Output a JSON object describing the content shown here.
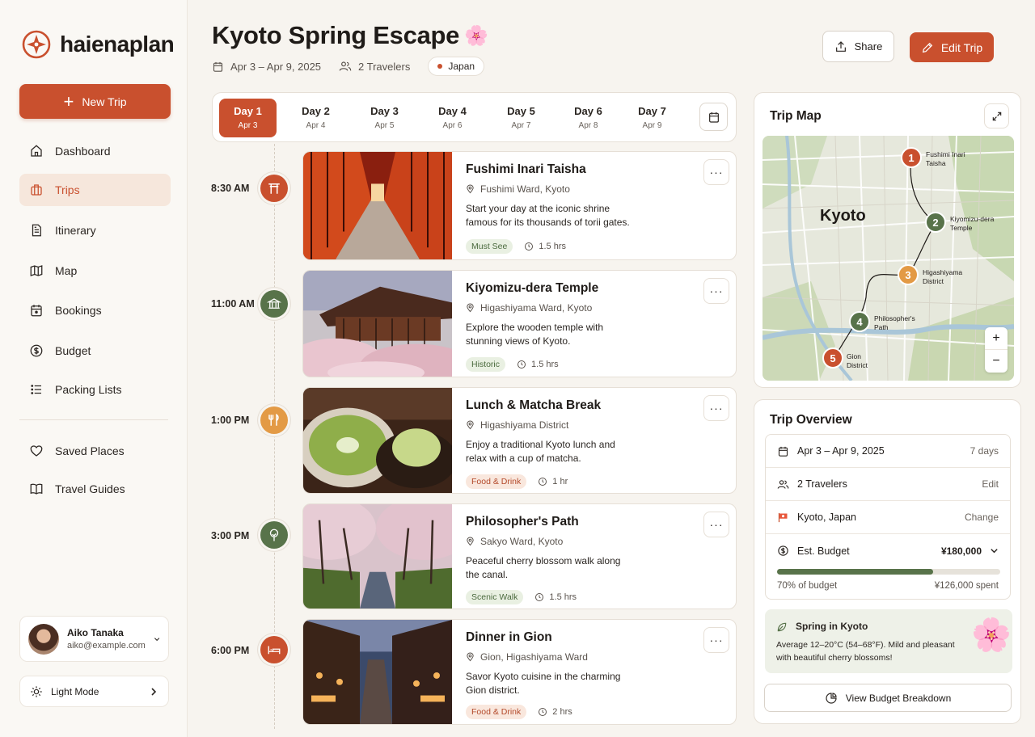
{
  "brand": {
    "name": "haienaplan"
  },
  "sidebar": {
    "new_trip": "New Trip",
    "items": [
      {
        "label": "Dashboard"
      },
      {
        "label": "Trips"
      },
      {
        "label": "Itinerary"
      },
      {
        "label": "Map"
      },
      {
        "label": "Bookings"
      },
      {
        "label": "Budget"
      },
      {
        "label": "Packing Lists"
      }
    ],
    "secondary": [
      {
        "label": "Saved Places"
      },
      {
        "label": "Travel Guides"
      }
    ],
    "user": {
      "name": "Aiko Tanaka",
      "email": "aiko@example.com"
    },
    "mode": "Light Mode"
  },
  "header": {
    "title": "Kyoto Spring Escape",
    "title_emoji": "🌸",
    "dates": "Apr 3 – Apr 9, 2025",
    "travelers": "2 Travelers",
    "country": "Japan",
    "share": "Share",
    "edit": "Edit Trip"
  },
  "days": [
    {
      "label": "Day 1",
      "date": "Apr 3"
    },
    {
      "label": "Day 2",
      "date": "Apr 4"
    },
    {
      "label": "Day 3",
      "date": "Apr 5"
    },
    {
      "label": "Day 4",
      "date": "Apr 6"
    },
    {
      "label": "Day 5",
      "date": "Apr 7"
    },
    {
      "label": "Day 6",
      "date": "Apr 8"
    },
    {
      "label": "Day 7",
      "date": "Apr 9"
    }
  ],
  "activities": [
    {
      "time": "8:30 AM",
      "title": "Fushimi Inari Taisha",
      "location": "Fushimi Ward, Kyoto",
      "desc": "Start your day at the iconic shrine famous for its thousands of torii gates.",
      "tag": "Must See",
      "duration": "1.5 hrs",
      "icon": "torii-icon",
      "color": "#c9502e"
    },
    {
      "time": "11:00 AM",
      "title": "Kiyomizu-dera Temple",
      "location": "Higashiyama Ward, Kyoto",
      "desc": "Explore the wooden temple with stunning views of Kyoto.",
      "tag": "Historic",
      "duration": "1.5 hrs",
      "icon": "temple-icon",
      "color": "#58734a"
    },
    {
      "time": "1:00 PM",
      "title": "Lunch & Matcha Break",
      "location": "Higashiyama District",
      "desc": "Enjoy a traditional Kyoto lunch and relax with a cup of matcha.",
      "tag": "Food & Drink",
      "duration": "1 hr",
      "icon": "utensils-icon",
      "color": "#e39a45"
    },
    {
      "time": "3:00 PM",
      "title": "Philosopher's Path",
      "location": "Sakyo Ward, Kyoto",
      "desc": "Peaceful cherry blossom walk along the canal.",
      "tag": "Scenic Walk",
      "duration": "1.5 hrs",
      "icon": "tree-icon",
      "color": "#58734a"
    },
    {
      "time": "6:00 PM",
      "title": "Dinner in Gion",
      "location": "Gion, Higashiyama Ward",
      "desc": "Savor Kyoto cuisine in the charming Gion district.",
      "tag": "Food & Drink",
      "duration": "2 hrs",
      "icon": "bed-icon",
      "color": "#c9502e"
    }
  ],
  "map": {
    "title": "Trip Map",
    "city": "Kyoto",
    "pins": [
      {
        "n": "1",
        "label_a": "Fushimi Inari",
        "label_b": "Taisha",
        "color": "#c9502e"
      },
      {
        "n": "2",
        "label_a": "Kiyomizu-dera",
        "label_b": "Temple",
        "color": "#58734a"
      },
      {
        "n": "3",
        "label_a": "Higashiyama",
        "label_b": "District",
        "color": "#e39a45"
      },
      {
        "n": "4",
        "label_a": "Philosopher's",
        "label_b": "Path",
        "color": "#58734a"
      },
      {
        "n": "5",
        "label_a": "Gion",
        "label_b": "District",
        "color": "#c9502e"
      }
    ]
  },
  "overview": {
    "title": "Trip Overview",
    "dates": "Apr 3 – Apr 9, 2025",
    "days": "7 days",
    "travelers": "2 Travelers",
    "edit": "Edit",
    "location": "Kyoto, Japan",
    "change": "Change",
    "budget_label": "Est. Budget",
    "budget_value": "¥180,000",
    "budget_percent": 70,
    "budget_pct_text": "70% of budget",
    "spent": "¥126,000 spent",
    "spring_title": "Spring in Kyoto",
    "spring_text": "Average 12–20°C (54–68°F). Mild and pleasant with beautiful cherry blossoms!",
    "breakdown": "View Budget Breakdown"
  }
}
